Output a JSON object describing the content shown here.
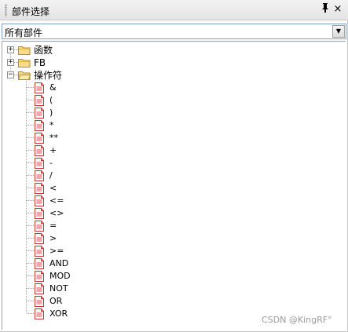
{
  "panel": {
    "title": "部件选择",
    "pin_icon": "pin-icon",
    "close_icon": "close-icon"
  },
  "filter": {
    "selected": "所有部件"
  },
  "tree": {
    "groups": [
      {
        "label": "函数",
        "expander": "+",
        "icon": "folder-closed-icon"
      },
      {
        "label": "FB",
        "expander": "+",
        "icon": "folder-closed-icon"
      },
      {
        "label": "操作符",
        "expander": "−",
        "icon": "folder-open-icon"
      }
    ],
    "operators": [
      "&",
      "(",
      ")",
      "*",
      "**",
      "+",
      "-",
      "/",
      "<",
      "<=",
      "<>",
      "=",
      ">",
      ">=",
      "AND",
      "MOD",
      "NOT",
      "OR",
      "XOR"
    ]
  },
  "watermark": "CSDN @KingRF°"
}
